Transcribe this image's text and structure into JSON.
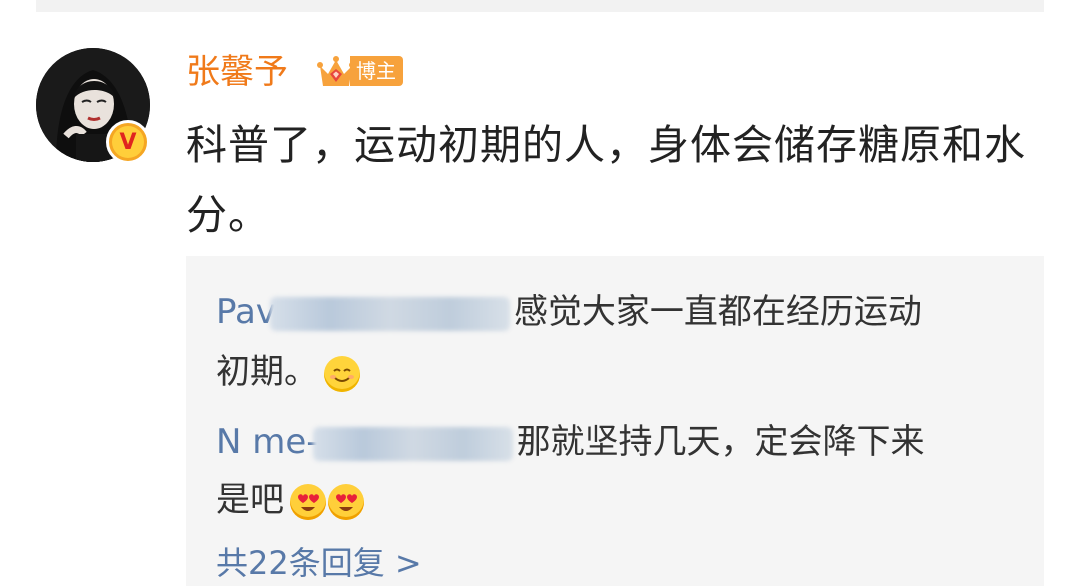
{
  "post": {
    "author": "张馨予",
    "role_badge": "博主",
    "text": "科普了，运动初期的人，身体会储存糖原和水分。"
  },
  "replies": [
    {
      "name_visible": "Pav",
      "text_line1": "感觉大家一直都在经历运动",
      "text_line2": "初期。",
      "emoji": "smile-emoji"
    },
    {
      "name_visible": "N me-",
      "text_line1": "那就坚持几天，定会降下来",
      "text_line2": "是吧",
      "emoji": "heart-eyes-emoji"
    }
  ],
  "more_replies": "共22条回复 >",
  "colors": {
    "author": "#f07a1a",
    "reply_name": "#5879a8",
    "link": "#5879a8",
    "reply_bg": "#f5f5f5",
    "verified_badge": "#f5a623"
  },
  "icons": [
    "avatar",
    "verified-v-icon",
    "crown-icon",
    "smile-emoji",
    "heart-eyes-emoji",
    "chevron-right-icon"
  ]
}
